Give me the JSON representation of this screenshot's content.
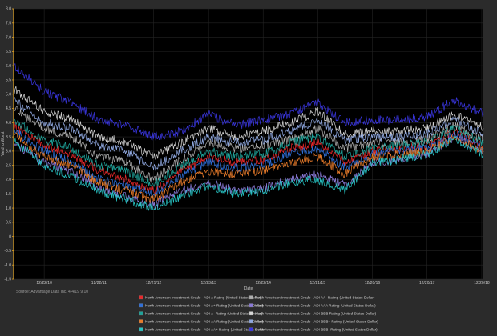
{
  "chart_data": {
    "type": "line",
    "xlabel": "Date",
    "ylabel": "Yield to Worst",
    "ylim": [
      -1.5,
      8.0
    ],
    "yticks": [
      8.0,
      7.5,
      7.0,
      6.5,
      6.0,
      5.5,
      5.0,
      4.5,
      4.0,
      3.5,
      3.0,
      2.5,
      2.0,
      1.5,
      1.0,
      0.5,
      0,
      -0.5,
      -1.0,
      -1.5
    ],
    "xlim": [
      "2010-06-01",
      "2018-12-31"
    ],
    "xticks": [
      {
        "label": "12/22/10",
        "date": "2010-12-22"
      },
      {
        "label": "12/22/11",
        "date": "2011-12-22"
      },
      {
        "label": "12/21/12",
        "date": "2012-12-21"
      },
      {
        "label": "12/23/13",
        "date": "2013-12-23"
      },
      {
        "label": "12/22/14",
        "date": "2014-12-22"
      },
      {
        "label": "12/21/15",
        "date": "2015-12-21"
      },
      {
        "label": "12/20/16",
        "date": "2016-12-20"
      },
      {
        "label": "12/20/17",
        "date": "2017-12-20"
      },
      {
        "label": "12/20/18",
        "date": "2018-12-20"
      }
    ],
    "grid": true,
    "legend_position": "bottom",
    "source": "Source: Advantage Data Inc. 4/4/19 9:10",
    "dates": [
      "2010-06-01",
      "2010-12-22",
      "2011-06-22",
      "2011-12-22",
      "2012-06-21",
      "2012-12-21",
      "2013-06-23",
      "2013-12-23",
      "2014-06-22",
      "2014-12-22",
      "2015-06-21",
      "2015-12-21",
      "2016-06-20",
      "2016-12-20",
      "2017-06-20",
      "2017-12-20",
      "2018-06-20",
      "2018-12-31"
    ],
    "series": [
      {
        "name": "North American Investment Grade - ADI A Rating (United States Dollar)",
        "color": "#e8292b",
        "values": [
          3.9,
          3.2,
          2.9,
          2.3,
          2.0,
          1.6,
          2.3,
          2.8,
          2.6,
          2.7,
          3.1,
          3.3,
          2.6,
          3.0,
          3.1,
          3.2,
          3.7,
          3.2
        ]
      },
      {
        "name": "North American Investment Grade - ADI AA- Rating (United States Dollar)",
        "color": "#b0b0b0",
        "values": [
          4.5,
          3.8,
          3.5,
          2.8,
          2.6,
          2.0,
          2.7,
          3.3,
          3.1,
          3.2,
          3.4,
          3.8,
          3.1,
          3.3,
          3.3,
          3.4,
          3.9,
          3.4
        ]
      },
      {
        "name": "North American Investment Grade - ADI A+ Rating (United States Dollar)",
        "color": "#2f6fd8",
        "values": [
          3.7,
          3.0,
          2.6,
          2.0,
          1.8,
          1.5,
          2.1,
          2.6,
          2.4,
          2.5,
          2.9,
          3.1,
          2.4,
          2.9,
          3.0,
          3.1,
          3.6,
          3.1
        ]
      },
      {
        "name": "North American Investment Grade - ADI AAA Rating (United States Dollar)",
        "color": "#8a7ad8",
        "values": [
          3.3,
          2.6,
          2.3,
          1.7,
          1.4,
          1.1,
          1.6,
          1.9,
          1.6,
          1.7,
          2.0,
          2.2,
          1.8,
          2.6,
          2.7,
          2.9,
          3.5,
          3.0
        ]
      },
      {
        "name": "North American Investment Grade - ADI A- Rating (United States Dollar)",
        "color": "#1fa39a",
        "values": [
          4.1,
          3.4,
          3.1,
          2.5,
          2.3,
          1.8,
          2.5,
          3.0,
          2.8,
          2.9,
          3.3,
          3.5,
          2.8,
          3.1,
          3.2,
          3.3,
          3.8,
          3.3
        ]
      },
      {
        "name": "North American Investment Grade - ADI BBB Rating (United States Dollar)",
        "color": "#d6d6d6",
        "values": [
          5.2,
          4.4,
          4.1,
          3.5,
          3.3,
          2.8,
          3.3,
          3.8,
          3.5,
          3.7,
          4.0,
          4.4,
          3.6,
          3.7,
          3.7,
          3.8,
          4.3,
          3.8
        ]
      },
      {
        "name": "North American Investment Grade - ADI AA Rating (United States Dollar)",
        "color": "#e87b2a",
        "values": [
          3.6,
          2.8,
          2.5,
          1.9,
          1.6,
          1.3,
          1.9,
          2.3,
          2.2,
          2.3,
          2.6,
          2.8,
          2.2,
          2.8,
          2.9,
          3.0,
          3.5,
          3.0
        ]
      },
      {
        "name": "North American Investment Grade - ADI BBB+ Rating (United States Dollar)",
        "color": "#8fa8e0",
        "values": [
          4.8,
          4.0,
          3.8,
          3.2,
          3.0,
          2.4,
          3.0,
          3.5,
          3.3,
          3.4,
          3.7,
          4.1,
          3.4,
          3.5,
          3.5,
          3.6,
          4.1,
          3.6
        ]
      },
      {
        "name": "North American Investment Grade - ADI AA+ Rating (United States Dollar)",
        "color": "#27c4c4",
        "values": [
          3.4,
          2.5,
          2.1,
          1.6,
          1.3,
          1.0,
          1.4,
          1.8,
          1.5,
          1.6,
          1.9,
          2.0,
          1.6,
          2.6,
          2.7,
          2.9,
          3.4,
          2.9
        ]
      },
      {
        "name": "North American Investment Grade - ADI BBB- Rating (United States Dollar)",
        "color": "#3a36e0",
        "values": [
          6.0,
          5.1,
          4.7,
          4.1,
          3.9,
          3.5,
          3.7,
          4.3,
          3.9,
          4.1,
          4.3,
          4.7,
          4.0,
          4.1,
          4.1,
          4.2,
          4.8,
          4.3
        ]
      }
    ]
  }
}
